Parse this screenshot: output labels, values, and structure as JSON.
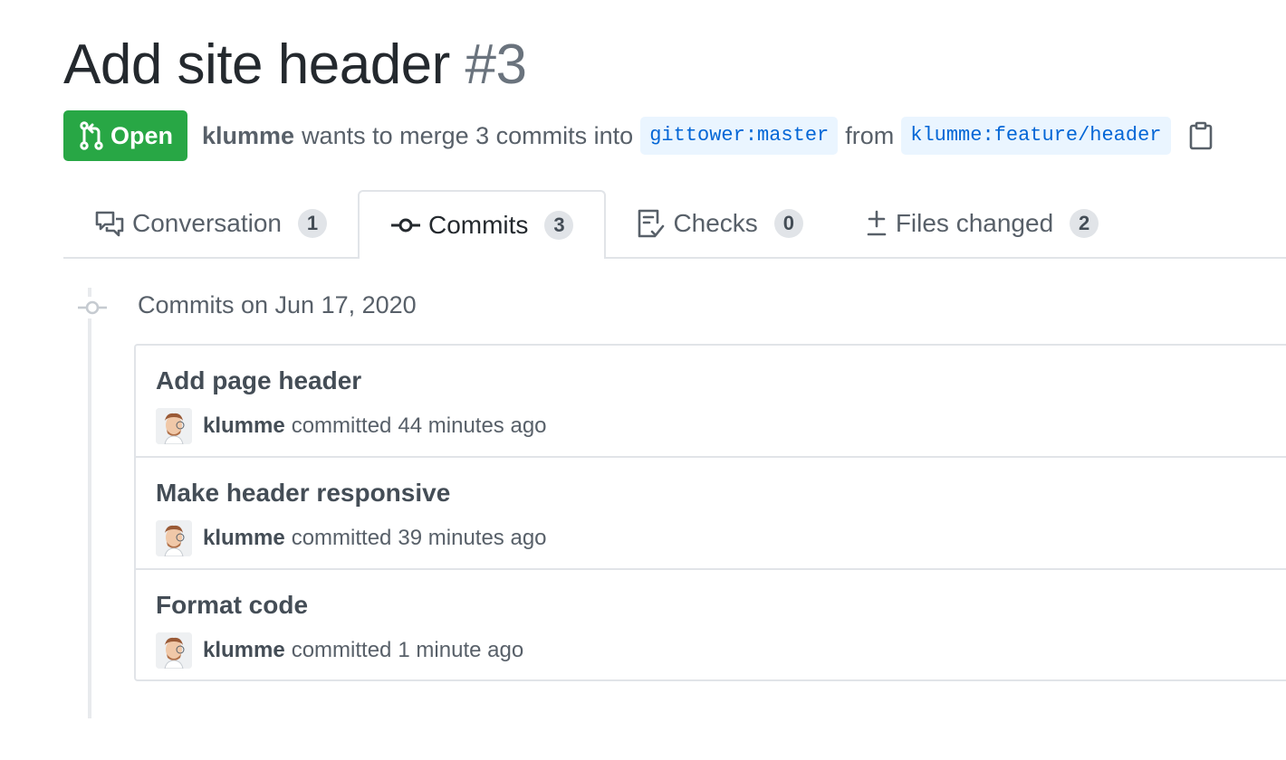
{
  "pr": {
    "title": "Add site header",
    "number": "#3",
    "state": "Open",
    "author": "klumme",
    "merge_text": "wants to merge 3 commits into",
    "base_branch": "gittower:master",
    "from_text": "from",
    "head_branch": "klumme:feature/header",
    "state_color": "#28a745"
  },
  "tabs": [
    {
      "label": "Conversation",
      "count": "1",
      "icon": "comment-discussion-icon",
      "selected": false
    },
    {
      "label": "Commits",
      "count": "3",
      "icon": "git-commit-icon",
      "selected": true
    },
    {
      "label": "Checks",
      "count": "0",
      "icon": "checklist-icon",
      "selected": false
    },
    {
      "label": "Files changed",
      "count": "2",
      "icon": "diff-icon",
      "selected": false
    }
  ],
  "timeline": {
    "date_header": "Commits on Jun 17, 2020",
    "commits": [
      {
        "message": "Add page header",
        "author": "klumme",
        "verb": "committed",
        "when": "44 minutes ago"
      },
      {
        "message": "Make header responsive",
        "author": "klumme",
        "verb": "committed",
        "when": "39 minutes ago"
      },
      {
        "message": "Format code",
        "author": "klumme",
        "verb": "committed",
        "when": "1 minute ago"
      }
    ]
  }
}
